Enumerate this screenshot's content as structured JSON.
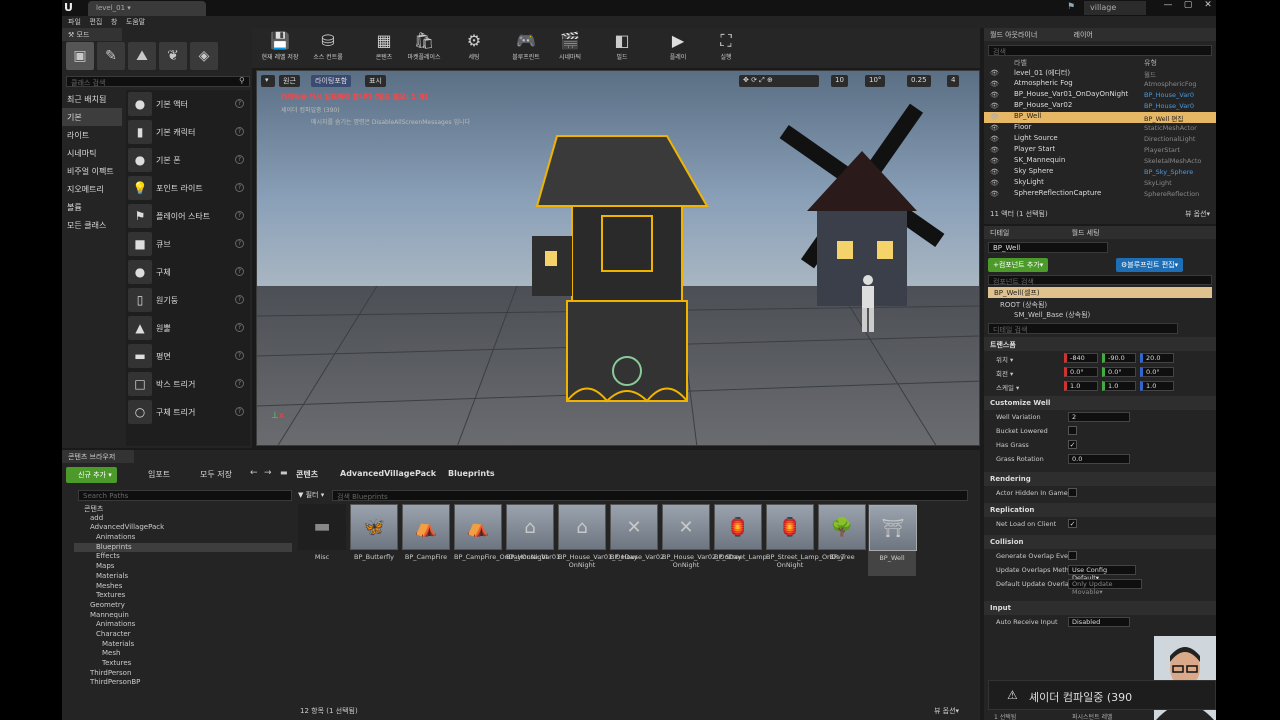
{
  "app": {
    "tab": "level_01 ▾",
    "project": "village",
    "logo": "U"
  },
  "menu": [
    "파일",
    "편집",
    "창",
    "도움말"
  ],
  "modes": {
    "tab": "모드",
    "search_placeholder": "클래스 검색",
    "categories": [
      "최근 배치됨",
      "기본",
      "라이트",
      "시네마틱",
      "비주얼 이펙트",
      "지오메트리",
      "볼륨",
      "모든 클래스"
    ],
    "selected_category": 1,
    "items": [
      "기본 액터",
      "기본 캐릭터",
      "기본 폰",
      "포인트 라이트",
      "플레이어 스타트",
      "큐브",
      "구체",
      "원기둥",
      "원뿔",
      "평면",
      "박스 트리거",
      "구체 트리거"
    ]
  },
  "toolbar": [
    "현재 레벨 저장",
    "소스 컨트롤",
    "콘텐츠",
    "마켓플레이스",
    "세팅",
    "블루프린트",
    "시네마틱",
    "빌드",
    "플레이",
    "실행"
  ],
  "viewport": {
    "pills": [
      "원근",
      "라이팅포함",
      "표시"
    ],
    "warning": "라이팅을 다시 빌드해야 합니다 (빌드 필요: 1 개)",
    "shader": "셰이더 컴파일중 (390)",
    "info": "메시지를 숨기는 명령은 DisableAllScreenMessages 입니다",
    "grid": "10",
    "angle": "10°",
    "scale": "0.25",
    "cam": "4"
  },
  "outliner": {
    "tabs": [
      "월드 아웃라이너",
      "레이어"
    ],
    "search_placeholder": "검색",
    "col_label": "라벨",
    "col_type": "유형",
    "rows": [
      {
        "label": "level_01 (에디터)",
        "type": "월드"
      },
      {
        "label": "Atmospheric Fog",
        "type": "AtmosphericFog"
      },
      {
        "label": "BP_House_Var01_OnDayOnNight",
        "type": "BP_House_Var0"
      },
      {
        "label": "BP_House_Var02",
        "type": "BP_House_Var0"
      },
      {
        "label": "BP_Well",
        "type": "BP_Well 편집"
      },
      {
        "label": "Floor",
        "type": "StaticMeshActor"
      },
      {
        "label": "Light Source",
        "type": "DirectionalLight"
      },
      {
        "label": "Player Start",
        "type": "PlayerStart"
      },
      {
        "label": "SK_Mannequin",
        "type": "SkeletalMeshActo"
      },
      {
        "label": "Sky Sphere",
        "type": "BP_Sky_Sphere"
      },
      {
        "label": "SkyLight",
        "type": "SkyLight"
      },
      {
        "label": "SphereReflectionCapture",
        "type": "SphereReflection"
      }
    ],
    "selected_row": 4,
    "footer": "11 액터 (1 선택됨)",
    "view_options": "뷰 옵션▾"
  },
  "details": {
    "tabs": [
      "디테일",
      "월드 세팅"
    ],
    "name": "BP_Well",
    "add_component": "+컴포넌트 추가▾",
    "edit_blueprint": "⚙블루프린트 편집▾",
    "comp_search": "컴포넌트 검색",
    "self": "BP_Well(셀프)",
    "root": "ROOT (상속됨)",
    "child": "SM_Well_Base (상속됨)",
    "detail_search": "디테일 검색",
    "transform": {
      "header": "트랜스폼",
      "location_label": "위치 ▾",
      "rotation_label": "회전 ▾",
      "scale_label": "스케일 ▾",
      "location": [
        "-840",
        "-90.0",
        "20.0"
      ],
      "rotation": [
        "0.0°",
        "0.0°",
        "0.0°"
      ],
      "scale": [
        "1.0",
        "1.0",
        "1.0"
      ]
    },
    "customize": {
      "header": "Customize Well",
      "rows": [
        "Well Variation",
        "Bucket Lowered",
        "Has Grass",
        "Grass Rotation"
      ],
      "variation": "2",
      "grass_rotation": "0.0"
    },
    "rendering": {
      "header": "Rendering",
      "row": "Actor Hidden In Game"
    },
    "replication": {
      "header": "Replication",
      "row": "Net Load on Client"
    },
    "collision": {
      "header": "Collision",
      "rows": [
        "Generate Overlap Ever",
        "Update Overlaps Meth",
        "Default Update Overla"
      ],
      "update": "Use Config Default▾",
      "default": "Only Update Movable▾"
    },
    "input": {
      "header": "Input",
      "row": "Auto Receive Input",
      "value": "Disabled"
    }
  },
  "content_browser": {
    "tab": "콘텐츠 브라우저",
    "new": "신규 추가 ▾",
    "import": "임포트",
    "save_all": "모두 저장",
    "crumbs": [
      "콘텐츠",
      "AdvancedVillagePack",
      "Blueprints"
    ],
    "search_paths": "Search Paths",
    "filter": "▼ 필터 ▾",
    "search_bp": "검색 Blueprints",
    "tree": [
      "콘텐츠",
      "add",
      "AdvancedVillagePack",
      "Animations",
      "Blueprints",
      "Effects",
      "Maps",
      "Materials",
      "Meshes",
      "Textures",
      "Geometry",
      "Mannequin",
      "Animations",
      "Character",
      "Materials",
      "Mesh",
      "Textures",
      "ThirdPerson",
      "ThirdPersonBP"
    ],
    "assets": [
      "Misc",
      "BP_Butterfly",
      "BP_CampFire",
      "BP_CampFire_OnDayOnNight",
      "BP_House_Var01",
      "BP_House_Var01_OnDay OnNight",
      "BP_House_Var02",
      "BP_House_Var02_OnDay OnNight",
      "BP_Street_Lamp",
      "BP_Street_Lamp_OnDay OnNight",
      "BP_Tree",
      "BP_Well"
    ],
    "footer": "12 항목 (1 선택됨)",
    "view_options": "뷰 옵션▾"
  },
  "notification": {
    "text": "셰이더 컴파일중 (390",
    "footer": "1 선택됨",
    "footer2": "퍼시스턴트 레벨"
  }
}
